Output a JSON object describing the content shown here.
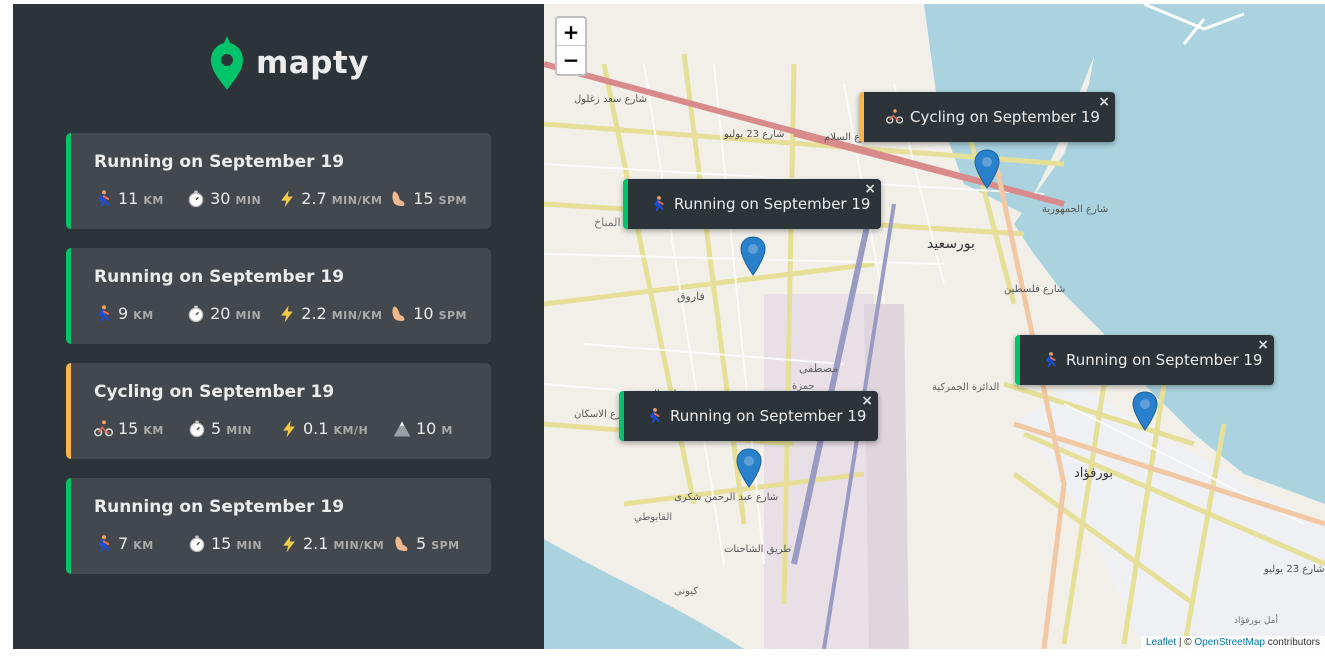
{
  "app": {
    "logo_text": "mapty"
  },
  "colors": {
    "running": "#00c46a",
    "cycling": "#ffb545",
    "sidebar": "#2d3439",
    "card": "#42484d"
  },
  "workouts": [
    {
      "type": "running",
      "title": "Running on September 19",
      "d1": {
        "icon": "runner-icon",
        "value": "11",
        "unit": "KM"
      },
      "d2": {
        "icon": "stopwatch-icon",
        "value": "30",
        "unit": "MIN"
      },
      "d3": {
        "icon": "lightning-icon",
        "value": "2.7",
        "unit": "MIN/KM"
      },
      "d4": {
        "icon": "footprint-icon",
        "value": "15",
        "unit": "SPM"
      }
    },
    {
      "type": "running",
      "title": "Running on September 19",
      "d1": {
        "icon": "runner-icon",
        "value": "9",
        "unit": "KM"
      },
      "d2": {
        "icon": "stopwatch-icon",
        "value": "20",
        "unit": "MIN"
      },
      "d3": {
        "icon": "lightning-icon",
        "value": "2.2",
        "unit": "MIN/KM"
      },
      "d4": {
        "icon": "footprint-icon",
        "value": "10",
        "unit": "SPM"
      }
    },
    {
      "type": "cycling",
      "title": "Cycling on September 19",
      "d1": {
        "icon": "cyclist-icon",
        "value": "15",
        "unit": "KM"
      },
      "d2": {
        "icon": "stopwatch-icon",
        "value": "5",
        "unit": "MIN"
      },
      "d3": {
        "icon": "lightning-icon",
        "value": "0.1",
        "unit": "KM/H"
      },
      "d4": {
        "icon": "mountain-icon",
        "value": "10",
        "unit": "M"
      }
    },
    {
      "type": "running",
      "title": "Running on September 19",
      "d1": {
        "icon": "runner-icon",
        "value": "7",
        "unit": "KM"
      },
      "d2": {
        "icon": "stopwatch-icon",
        "value": "15",
        "unit": "MIN"
      },
      "d3": {
        "icon": "lightning-icon",
        "value": "2.1",
        "unit": "MIN/KM"
      },
      "d4": {
        "icon": "footprint-icon",
        "value": "5",
        "unit": "SPM"
      }
    }
  ],
  "map": {
    "zoom_in": "+",
    "zoom_out": "−",
    "popups": [
      {
        "type": "cycling",
        "text": "Cycling on September 19",
        "close": "×"
      },
      {
        "type": "running",
        "text": "Running on September 19",
        "close": "×"
      },
      {
        "type": "running",
        "text": "Running on September 19",
        "close": "×"
      },
      {
        "type": "running",
        "text": "Running on September 19",
        "close": "×"
      }
    ],
    "labels": [
      "بورسعيد",
      "بورفؤاد",
      "فاروق",
      "مصطفى",
      "حمزة",
      "الدائرة الجمركية",
      "المناخ",
      "القابوطي",
      "كيونى",
      "شارع 23 يوليو",
      "شارع سعد زغلول",
      "شارع الجمهورية",
      "شارع عبد الرحمن شكرى",
      "طريق الشاحنات",
      "شارع فلسطين",
      "شارع 23 يوليو",
      "شارع السلام",
      "شارع الاسكان",
      "شارع العبور",
      "أمل بورفؤاد"
    ],
    "attribution": {
      "leaflet": "Leaflet",
      "sep": " | © ",
      "osm": "OpenStreetMap",
      "tail": " contributors"
    }
  }
}
